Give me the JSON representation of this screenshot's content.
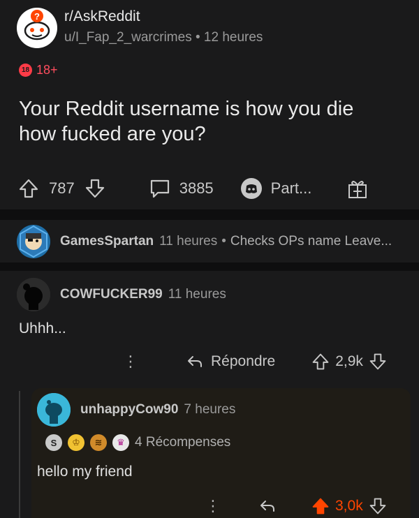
{
  "post": {
    "subreddit": "r/AskReddit",
    "author": "u/I_Fap_2_warcrimes",
    "dot": "•",
    "time": "12 heures",
    "nsfw_badge": "18",
    "nsfw_label": "18+",
    "title": "Your Reddit username is how you die how fucked are you?",
    "upvotes": "787",
    "comments": "3885",
    "share_label": "Part...",
    "icons": [
      "upvote-icon",
      "downvote-icon",
      "comment-icon",
      "discord-icon",
      "gift-icon"
    ]
  },
  "pinned_comment": {
    "user": "GamesSpartan",
    "time": "11 heures",
    "dot": "•",
    "preview": "Checks OPs name Leave..."
  },
  "comment": {
    "user": "COWFUCKER99",
    "time": "11 heures",
    "body": "Uhhh...",
    "more": "⋮",
    "reply_label": "Répondre",
    "score": "2,9k"
  },
  "reply": {
    "user": "unhappyCow90",
    "time": "7 heures",
    "awards_label": "4 Récompenses",
    "body": "hello my friend",
    "more": "⋮",
    "score": "3,0k"
  },
  "colors": {
    "background": "#1a1a1b",
    "separator": "#0e0e0f",
    "nsfw": "#ff3b47",
    "upvoted": "#ff4500",
    "reply_card": "#1f1c16"
  }
}
